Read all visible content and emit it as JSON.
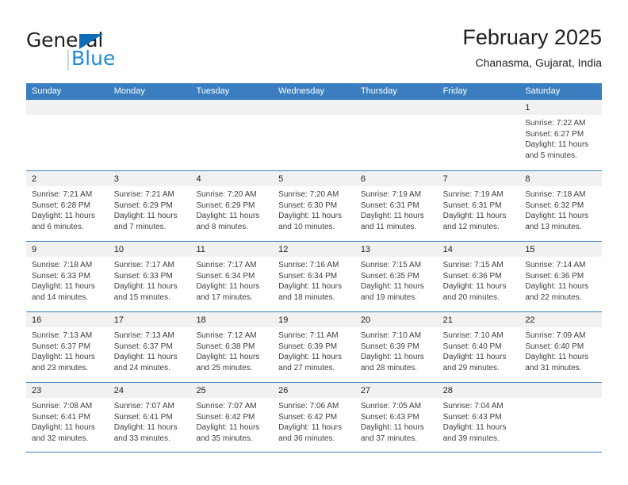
{
  "brand": {
    "name_part1": "General",
    "name_part2": "Blue",
    "triangle_color": "#0f6cb5",
    "blue_color": "#2089d4"
  },
  "header": {
    "title": "February 2025",
    "location": "Chanasma, Gujarat, India"
  },
  "theme": {
    "header_blue": "#3a7ebf",
    "day_band_gray": "#f1f1f1",
    "text_color": "#231f20"
  },
  "weekdays": [
    "Sunday",
    "Monday",
    "Tuesday",
    "Wednesday",
    "Thursday",
    "Friday",
    "Saturday"
  ],
  "weeks": [
    [
      {
        "day": "",
        "lines": []
      },
      {
        "day": "",
        "lines": []
      },
      {
        "day": "",
        "lines": []
      },
      {
        "day": "",
        "lines": []
      },
      {
        "day": "",
        "lines": []
      },
      {
        "day": "",
        "lines": []
      },
      {
        "day": "1",
        "lines": [
          "Sunrise: 7:22 AM",
          "Sunset: 6:27 PM",
          "Daylight: 11 hours",
          "and 5 minutes."
        ]
      }
    ],
    [
      {
        "day": "2",
        "lines": [
          "Sunrise: 7:21 AM",
          "Sunset: 6:28 PM",
          "Daylight: 11 hours",
          "and 6 minutes."
        ]
      },
      {
        "day": "3",
        "lines": [
          "Sunrise: 7:21 AM",
          "Sunset: 6:29 PM",
          "Daylight: 11 hours",
          "and 7 minutes."
        ]
      },
      {
        "day": "4",
        "lines": [
          "Sunrise: 7:20 AM",
          "Sunset: 6:29 PM",
          "Daylight: 11 hours",
          "and 8 minutes."
        ]
      },
      {
        "day": "5",
        "lines": [
          "Sunrise: 7:20 AM",
          "Sunset: 6:30 PM",
          "Daylight: 11 hours",
          "and 10 minutes."
        ]
      },
      {
        "day": "6",
        "lines": [
          "Sunrise: 7:19 AM",
          "Sunset: 6:31 PM",
          "Daylight: 11 hours",
          "and 11 minutes."
        ]
      },
      {
        "day": "7",
        "lines": [
          "Sunrise: 7:19 AM",
          "Sunset: 6:31 PM",
          "Daylight: 11 hours",
          "and 12 minutes."
        ]
      },
      {
        "day": "8",
        "lines": [
          "Sunrise: 7:18 AM",
          "Sunset: 6:32 PM",
          "Daylight: 11 hours",
          "and 13 minutes."
        ]
      }
    ],
    [
      {
        "day": "9",
        "lines": [
          "Sunrise: 7:18 AM",
          "Sunset: 6:33 PM",
          "Daylight: 11 hours",
          "and 14 minutes."
        ]
      },
      {
        "day": "10",
        "lines": [
          "Sunrise: 7:17 AM",
          "Sunset: 6:33 PM",
          "Daylight: 11 hours",
          "and 15 minutes."
        ]
      },
      {
        "day": "11",
        "lines": [
          "Sunrise: 7:17 AM",
          "Sunset: 6:34 PM",
          "Daylight: 11 hours",
          "and 17 minutes."
        ]
      },
      {
        "day": "12",
        "lines": [
          "Sunrise: 7:16 AM",
          "Sunset: 6:34 PM",
          "Daylight: 11 hours",
          "and 18 minutes."
        ]
      },
      {
        "day": "13",
        "lines": [
          "Sunrise: 7:15 AM",
          "Sunset: 6:35 PM",
          "Daylight: 11 hours",
          "and 19 minutes."
        ]
      },
      {
        "day": "14",
        "lines": [
          "Sunrise: 7:15 AM",
          "Sunset: 6:36 PM",
          "Daylight: 11 hours",
          "and 20 minutes."
        ]
      },
      {
        "day": "15",
        "lines": [
          "Sunrise: 7:14 AM",
          "Sunset: 6:36 PM",
          "Daylight: 11 hours",
          "and 22 minutes."
        ]
      }
    ],
    [
      {
        "day": "16",
        "lines": [
          "Sunrise: 7:13 AM",
          "Sunset: 6:37 PM",
          "Daylight: 11 hours",
          "and 23 minutes."
        ]
      },
      {
        "day": "17",
        "lines": [
          "Sunrise: 7:13 AM",
          "Sunset: 6:37 PM",
          "Daylight: 11 hours",
          "and 24 minutes."
        ]
      },
      {
        "day": "18",
        "lines": [
          "Sunrise: 7:12 AM",
          "Sunset: 6:38 PM",
          "Daylight: 11 hours",
          "and 25 minutes."
        ]
      },
      {
        "day": "19",
        "lines": [
          "Sunrise: 7:11 AM",
          "Sunset: 6:39 PM",
          "Daylight: 11 hours",
          "and 27 minutes."
        ]
      },
      {
        "day": "20",
        "lines": [
          "Sunrise: 7:10 AM",
          "Sunset: 6:39 PM",
          "Daylight: 11 hours",
          "and 28 minutes."
        ]
      },
      {
        "day": "21",
        "lines": [
          "Sunrise: 7:10 AM",
          "Sunset: 6:40 PM",
          "Daylight: 11 hours",
          "and 29 minutes."
        ]
      },
      {
        "day": "22",
        "lines": [
          "Sunrise: 7:09 AM",
          "Sunset: 6:40 PM",
          "Daylight: 11 hours",
          "and 31 minutes."
        ]
      }
    ],
    [
      {
        "day": "23",
        "lines": [
          "Sunrise: 7:08 AM",
          "Sunset: 6:41 PM",
          "Daylight: 11 hours",
          "and 32 minutes."
        ]
      },
      {
        "day": "24",
        "lines": [
          "Sunrise: 7:07 AM",
          "Sunset: 6:41 PM",
          "Daylight: 11 hours",
          "and 33 minutes."
        ]
      },
      {
        "day": "25",
        "lines": [
          "Sunrise: 7:07 AM",
          "Sunset: 6:42 PM",
          "Daylight: 11 hours",
          "and 35 minutes."
        ]
      },
      {
        "day": "26",
        "lines": [
          "Sunrise: 7:06 AM",
          "Sunset: 6:42 PM",
          "Daylight: 11 hours",
          "and 36 minutes."
        ]
      },
      {
        "day": "27",
        "lines": [
          "Sunrise: 7:05 AM",
          "Sunset: 6:43 PM",
          "Daylight: 11 hours",
          "and 37 minutes."
        ]
      },
      {
        "day": "28",
        "lines": [
          "Sunrise: 7:04 AM",
          "Sunset: 6:43 PM",
          "Daylight: 11 hours",
          "and 39 minutes."
        ]
      },
      {
        "day": "",
        "lines": []
      }
    ]
  ]
}
